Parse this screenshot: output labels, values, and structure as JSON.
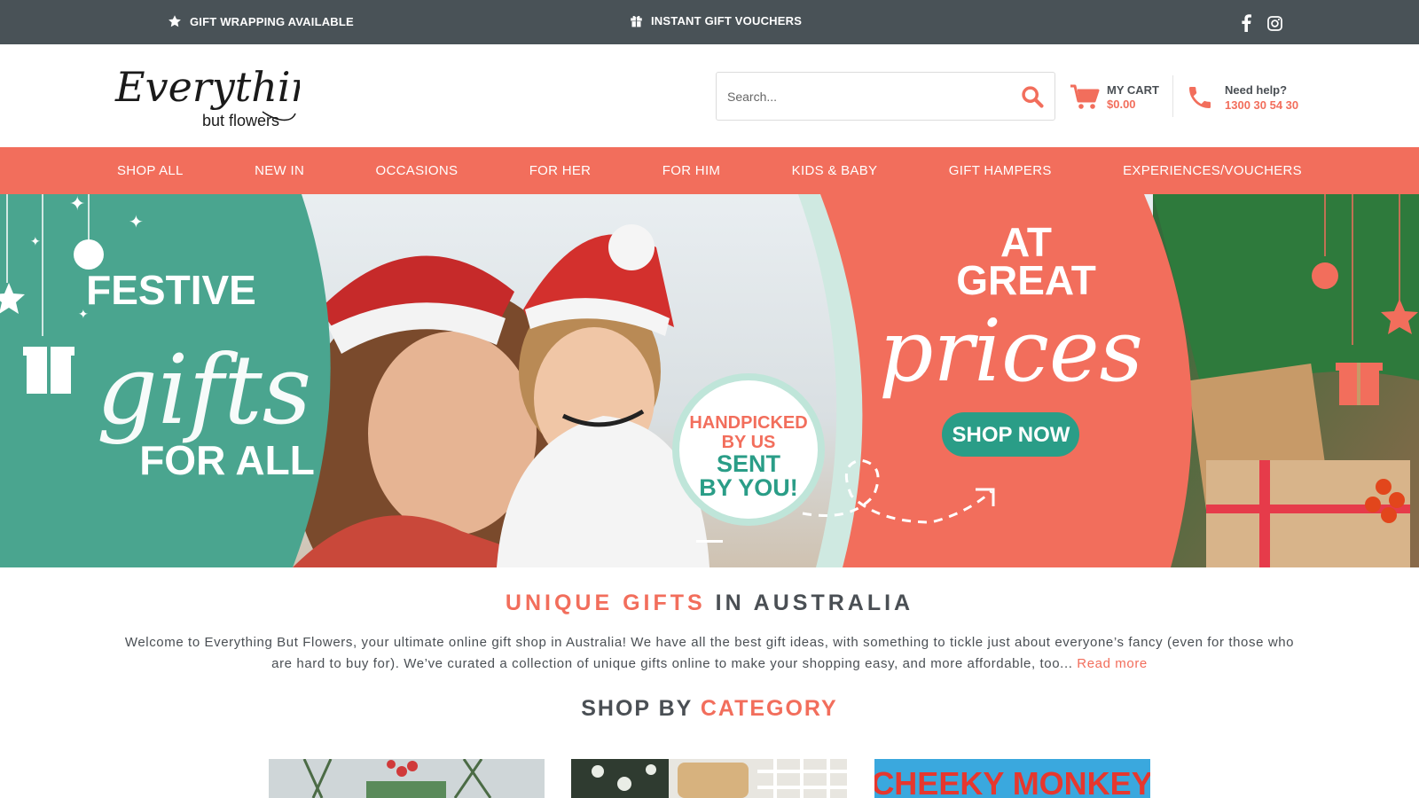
{
  "topbar": {
    "promo1": "GIFT WRAPPING AVAILABLE",
    "promo2": "INSTANT GIFT VOUCHERS",
    "promo1_icon": "star-icon",
    "promo2_icon": "gift-icon",
    "social": [
      "facebook-icon",
      "instagram-icon"
    ]
  },
  "brand": {
    "logo_line1": "Everything",
    "logo_line2": "but flowers"
  },
  "search": {
    "placeholder": "Search..."
  },
  "cart": {
    "label": "MY CART",
    "amount": "$0.00"
  },
  "help": {
    "label": "Need help?",
    "phone": "1300 30 54 30"
  },
  "nav": {
    "items": [
      "SHOP ALL",
      "NEW IN",
      "OCCASIONS",
      "FOR HER",
      "FOR HIM",
      "KIDS & BABY",
      "GIFT HAMPERS",
      "EXPERIENCES/VOUCHERS"
    ]
  },
  "banner": {
    "left_line1": "FESTIVE",
    "left_script": "gifts",
    "left_line2": "FOR ALL",
    "badge_line1": "HANDPICKED",
    "badge_line2": "BY US",
    "badge_line3": "SENT",
    "badge_line4": "BY YOU!",
    "right_line1": "AT",
    "right_line2": "GREAT",
    "right_script": "prices",
    "cta": "SHOP NOW"
  },
  "intro": {
    "title_accent": "UNIQUE GIFTS",
    "title_rest": "IN AUSTRALIA",
    "text": "Welcome to Everything But Flowers, your ultimate online gift shop in Australia! We have all the best gift ideas, with something to tickle just about everyone’s fancy (even for those who are hard to buy for). We’ve curated a collection of unique gifts online to make your shopping easy, and more affordable, too...",
    "read_more": "Read more"
  },
  "categories": {
    "title_plain": "SHOP BY",
    "title_accent": "CATEGORY",
    "card3_text": "CHEEKY MONKEY"
  },
  "colors": {
    "topbar": "#495257",
    "accent": "#f26e5c",
    "teal": "#4aa58f",
    "cta": "#2a9d87"
  }
}
